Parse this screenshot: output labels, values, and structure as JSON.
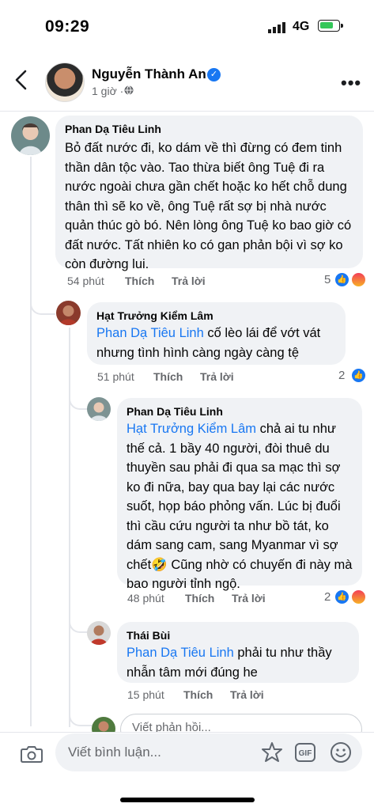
{
  "status_bar": {
    "time": "09:29",
    "network": "4G"
  },
  "header": {
    "name": "Nguyễn Thành An",
    "time": "1 giờ ·"
  },
  "comments": [
    {
      "name": "Phan Dạ Tiêu Linh",
      "text": "Bỏ đất nước đi, ko dám về thì đừng có đem tinh thần dân tộc vào. Tao thừa biết ông Tuệ đi ra nước ngoài chưa gần chết hoặc ko hết chỗ dung thân thì sẽ ko về, ông Tuệ rất sợ bị nhà nước quản thúc gò bó. Nên lòng ông Tuệ ko bao giờ có đất nước. Tất nhiên ko có gan phản bội vì sợ ko còn đường lui.",
      "time": "54 phút",
      "like": "Thích",
      "reply": "Trả lời",
      "count": "5"
    },
    {
      "name": "Hạt Trưởng Kiểm Lâm",
      "mention": "Phan Dạ Tiêu Linh",
      "text": " cố lèo lái để vớt vát nhưng tình hình càng ngày càng tệ",
      "time": "51 phút",
      "like": "Thích",
      "reply": "Trả lời",
      "count": "2"
    },
    {
      "name": "Phan Dạ Tiêu Linh",
      "mention": "Hạt Trưởng Kiểm Lâm",
      "text": " chả ai tu như thế cả. 1 bầy 40 người, đòi thuê du thuyền sau phải đi qua sa mạc thì sợ ko đi nữa, bay qua bay lại các nước suốt, họp báo phỏng vấn. Lúc bị đuổi thì cầu cứu người ta như bồ tát, ko dám sang cam, sang Myanmar vì sợ chết🤣 Cũng nhờ có chuyến đi này mà bao người tỉnh ngộ.",
      "time": "48 phút",
      "like": "Thích",
      "reply": "Trả lời",
      "count": "2"
    },
    {
      "name": "Thái Bùi",
      "mention": "Phan Dạ Tiêu Linh",
      "text": " phải tu như thầy nhẫn tâm mới đúng he",
      "time": "15 phút",
      "like": "Thích",
      "reply": "Trả lời"
    }
  ],
  "reply_box": {
    "placeholder": "Viết phản hồi..."
  },
  "comment_box": {
    "placeholder": "Viết bình luận...",
    "gif": "GIF"
  },
  "colors": {
    "accent": "#1877f2",
    "bubble": "#f0f2f5",
    "muted": "#65676b"
  },
  "icons": [
    "back-icon",
    "verified-icon",
    "globe-icon",
    "more-icon",
    "like-reaction-icon",
    "angry-reaction-icon",
    "camera-icon",
    "sticker-icon",
    "gif-icon",
    "emoji-icon"
  ]
}
